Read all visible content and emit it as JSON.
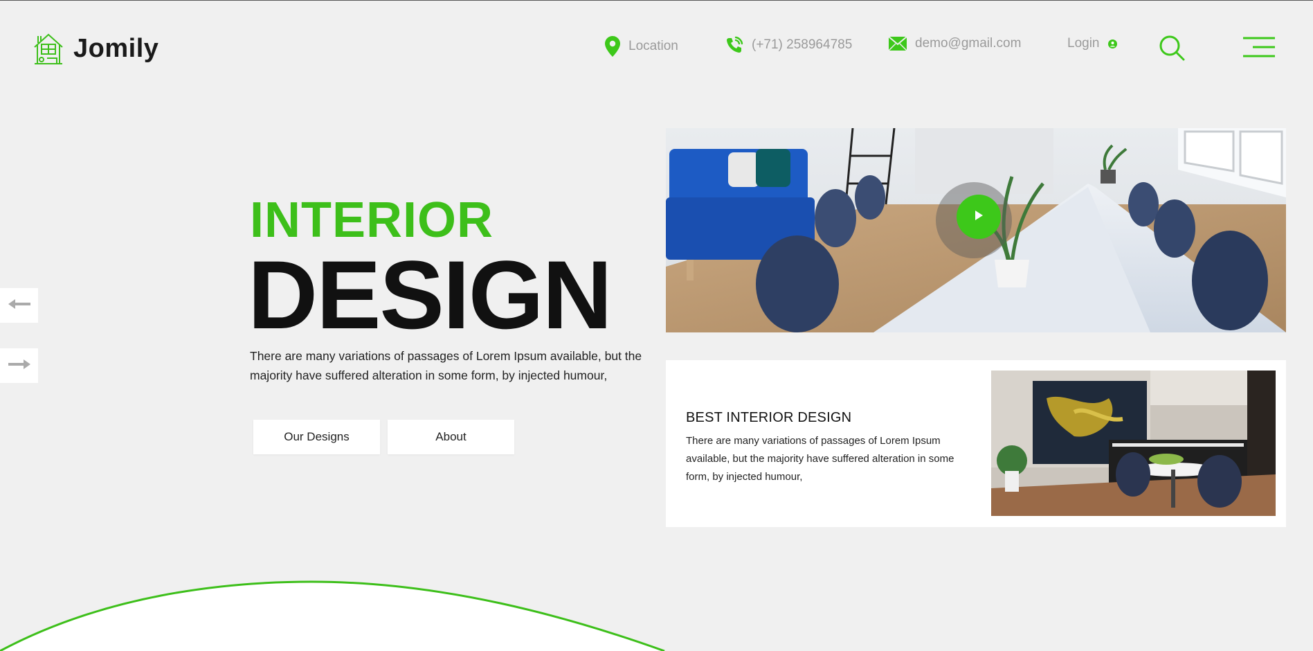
{
  "header": {
    "logo_text": "Jomily",
    "location_label": "Location",
    "phone_label": "(+71) 258964785",
    "email_label": "demo@gmail.com",
    "login_label": "Login"
  },
  "hero": {
    "title_small": "INTERIOR",
    "title_big": "DESIGN",
    "description": "There are many variations of passages of Lorem Ipsum available, but the majority have suffered alteration in some form, by injected humour,",
    "buttons": {
      "designs_label": "Our Designs",
      "about_label": "About"
    }
  },
  "feature_card": {
    "title": "BEST INTERIOR DESIGN",
    "description": "There are many variations of passages of Lorem Ipsum available, but the majority have suffered alteration in some form, by injected humour,"
  },
  "colors": {
    "accent": "#3dc81a",
    "background": "#f0f0f0",
    "text_dark": "#111111",
    "text_muted": "#9a9a9a"
  },
  "icons": {
    "logo": "house-icon",
    "location": "map-pin-icon",
    "phone": "phone-icon",
    "email": "envelope-icon",
    "login": "user-icon",
    "search": "search-icon",
    "menu": "hamburger-menu-icon",
    "prev": "arrow-left-icon",
    "next": "arrow-right-icon",
    "play": "play-icon"
  }
}
